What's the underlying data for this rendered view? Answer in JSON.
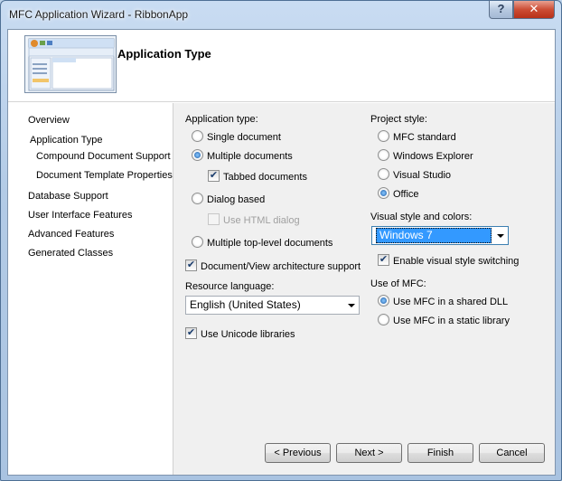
{
  "window": {
    "title": "MFC Application Wizard - RibbonApp",
    "help_label": "?",
    "close_label": "✕"
  },
  "header": {
    "title": "Application Type"
  },
  "nav": {
    "items": [
      {
        "label": "Overview"
      },
      {
        "label": "Application Type"
      },
      {
        "label": "Compound Document Support"
      },
      {
        "label": "Document Template Properties"
      },
      {
        "label": "Database Support"
      },
      {
        "label": "User Interface Features"
      },
      {
        "label": "Advanced Features"
      },
      {
        "label": "Generated Classes"
      }
    ]
  },
  "app_type": {
    "heading": "Application type:",
    "single": "Single document",
    "multiple": "Multiple documents",
    "tabbed": "Tabbed documents",
    "dialog": "Dialog based",
    "html_dialog": "Use HTML dialog",
    "multi_top": "Multiple top-level documents",
    "selected": "Multiple documents"
  },
  "doc_view": {
    "label": "Document/View architecture support",
    "checked": true
  },
  "resource": {
    "heading": "Resource language:",
    "value": "English (United States)"
  },
  "unicode": {
    "label": "Use Unicode libraries",
    "checked": true
  },
  "project_style": {
    "heading": "Project style:",
    "mfc_standard": "MFC standard",
    "explorer": "Windows Explorer",
    "vs": "Visual Studio",
    "office": "Office",
    "selected": "Office"
  },
  "visual_style": {
    "heading": "Visual style and colors:",
    "value": "Windows 7"
  },
  "style_switch": {
    "label": "Enable visual style switching",
    "checked": true
  },
  "use_mfc": {
    "heading": "Use of MFC:",
    "shared": "Use MFC in a shared DLL",
    "static": "Use MFC in a static library",
    "selected": "Use MFC in a shared DLL"
  },
  "buttons": {
    "previous": "< Previous",
    "next": "Next >",
    "finish": "Finish",
    "cancel": "Cancel"
  }
}
